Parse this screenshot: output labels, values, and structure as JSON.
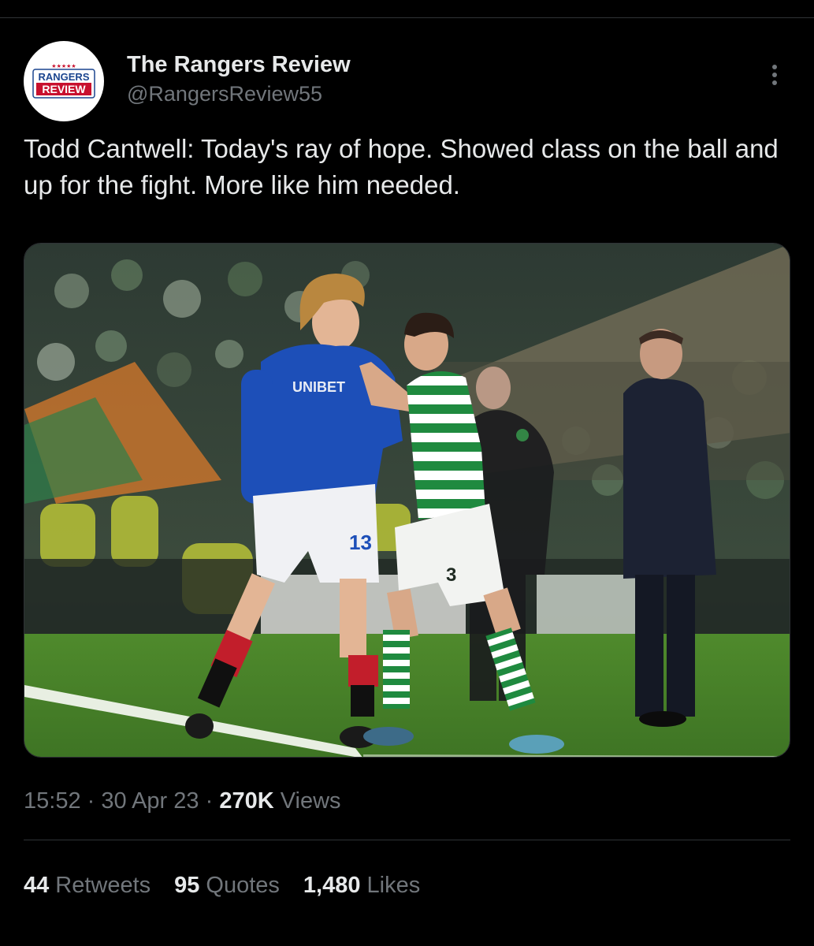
{
  "author": {
    "display_name": "The Rangers Review",
    "handle": "@RangersReview55",
    "logo_text_top": "RANGERS",
    "logo_text_bottom": "REVIEW",
    "logo_stars": "★★★★★"
  },
  "tweet": {
    "text": "Todd Cantwell: Today's ray of hope. Showed class on the ball and up for the fight. More like him needed."
  },
  "media": {
    "shirt_sponsor": "UNIBET",
    "rangers_number": "13",
    "celtic_number": "3"
  },
  "meta": {
    "time": "15:52",
    "separator": "·",
    "date": "30 Apr 23",
    "views_count": "270K",
    "views_label": "Views"
  },
  "stats": {
    "retweets_count": "44",
    "retweets_label": "Retweets",
    "quotes_count": "95",
    "quotes_label": "Quotes",
    "likes_count": "1,480",
    "likes_label": "Likes"
  },
  "colors": {
    "background": "#000000",
    "text_primary": "#e7e9ea",
    "text_secondary": "#71767b",
    "divider": "#2f3336",
    "logo_red": "#c8102e",
    "logo_blue": "#1b458f"
  }
}
